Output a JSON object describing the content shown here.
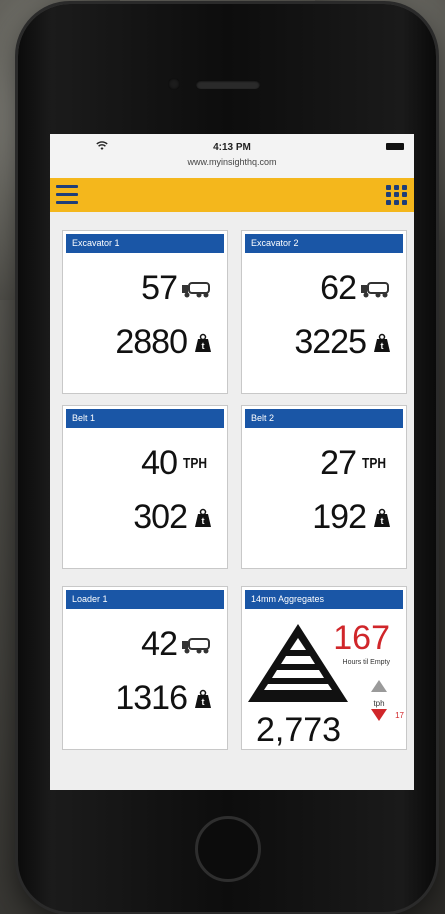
{
  "status_bar": {
    "time": "4:13 PM",
    "url": "www.myinsighthq.com"
  },
  "header": {
    "accent_color": "#f4b71c",
    "icon_color": "#1f3e78"
  },
  "tiles": [
    {
      "title": "Excavator 1",
      "value1": "57",
      "icon1": "truck-icon",
      "value2": "2880",
      "icon2": "weight-icon"
    },
    {
      "title": "Excavator 2",
      "value1": "62",
      "icon1": "truck-icon",
      "value2": "3225",
      "icon2": "weight-icon"
    },
    {
      "title": "Belt 1",
      "value1": "40",
      "unit1": "TPH",
      "value2": "302",
      "icon2": "weight-icon"
    },
    {
      "title": "Belt 2",
      "value1": "27",
      "unit1": "TPH",
      "value2": "192",
      "icon2": "weight-icon"
    },
    {
      "title": "Loader 1",
      "value1": "42",
      "icon1": "truck-icon",
      "value2": "1316",
      "icon2": "weight-icon"
    }
  ],
  "aggregates": {
    "title": "14mm Aggregates",
    "hours": "167",
    "hours_label": "Hours til Empty",
    "total": "2,773",
    "tph_label": "tph",
    "tph_down": "17",
    "up_color": "#9a9a9a",
    "down_color": "#d0262a"
  }
}
